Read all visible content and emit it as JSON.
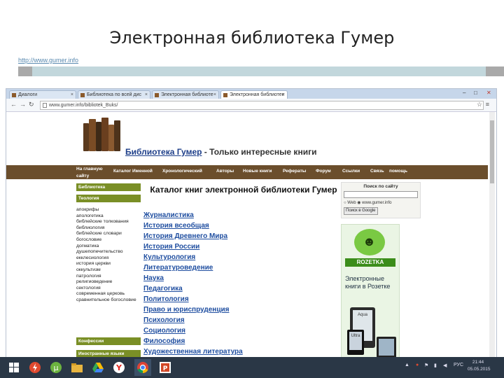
{
  "slide": {
    "title": "Электронная библиотека Гумер",
    "link": "http://www.gumer.info"
  },
  "browser": {
    "tabs": [
      {
        "label": "Диалоги"
      },
      {
        "label": "Библиотека по всей дис"
      },
      {
        "label": "Электронная библиоте"
      },
      {
        "label": "Электронная библиотек"
      }
    ],
    "url": "www.gumer.info/bibliotek_Buks/",
    "window_controls": {
      "minimize": "–",
      "restore": "□",
      "close": "✕"
    }
  },
  "site": {
    "title_main": "Библиотека Гумер",
    "title_rest": " - Только интересные книги",
    "nav": [
      {
        "label": "На главную"
      },
      {
        "label": "Каталог Именной"
      },
      {
        "label": "Хронологический"
      },
      {
        "label": "Авторы"
      },
      {
        "label": "Новые книги"
      },
      {
        "label": "Рефераты"
      },
      {
        "label": "Форум"
      },
      {
        "label": "Ссылки"
      },
      {
        "label": "Связь"
      },
      {
        "label": "помощь"
      }
    ],
    "nav_subline": "сайту",
    "sidebar": {
      "head_library": "Библиотека",
      "head_theology": "Теология",
      "theology_links": [
        "апокрифы",
        "апологетика",
        "библейские толкования",
        "библиология",
        "библейские словари",
        "богословие",
        "догматика",
        "душепопечительство",
        "екклесиология",
        "история церкви",
        "оккультизм",
        "патрология",
        "религиоведение",
        "сектология",
        "современная церковь",
        "сравнительное богословие"
      ],
      "head_confessions": "Конфессии",
      "head_languages": "Иностранные языки"
    },
    "catalog_heading": "Каталог книг электронной библиотеки Гумер",
    "categories": [
      "Журналистика",
      "История всеобщая",
      "История Древнего Мира",
      "История России",
      "Культурология",
      "Литературоведение",
      "Наука",
      "Педагогика",
      "Политология",
      "Право и юриспруденция",
      "Психология",
      "Социология",
      "Философия",
      "Художественная литература"
    ],
    "search": {
      "title": "Поиск по сайту",
      "radio_web": "Web",
      "radio_site": "www.gumer.info",
      "button": "Поиск в Google"
    },
    "ad": {
      "brand": "ROZETKA",
      "text": "Электронные книги в Розетке",
      "device_labels": [
        "Aqua",
        "Ultra"
      ]
    }
  },
  "taskbar": {
    "clock_time": "21:44",
    "clock_date": "05.05.2015",
    "lang": "РУС"
  }
}
